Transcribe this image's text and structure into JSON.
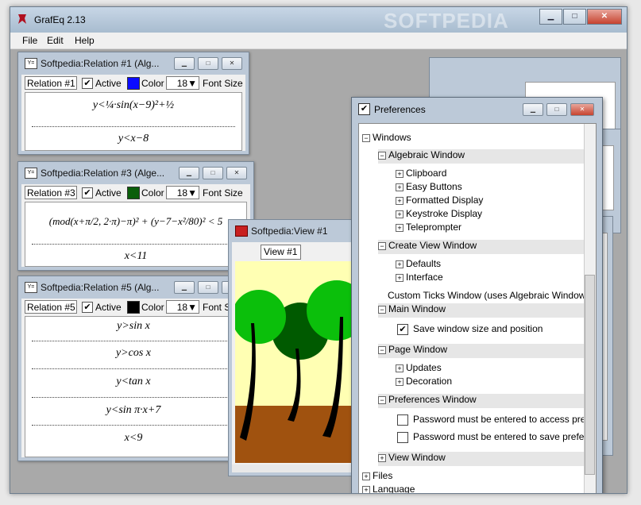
{
  "app": {
    "title": "GrafEq 2.13",
    "watermark": "SOFTPEDIA"
  },
  "menu": [
    "File",
    "Edit",
    "Help"
  ],
  "relations": [
    {
      "title": "Softpedia:Relation #1 (Alg...",
      "name": "Relation #1",
      "active_label": "Active",
      "active": true,
      "color_label": "Color",
      "color": "#0b0bff",
      "font_size": "18",
      "font_size_label": "Font Size",
      "formulas": [
        "y<¼·sin(x−9)²+½",
        "y<x−8"
      ]
    },
    {
      "title": "Softpedia:Relation #3 (Alge...",
      "name": "Relation #3",
      "active_label": "Active",
      "active": true,
      "color_label": "Color",
      "color": "#0a5e0a",
      "font_size": "18",
      "font_size_label": "Font Size",
      "formulas": [
        "(mod(x+π/2, 2·π)−π)² + (y−7−x²/80)² < 5",
        "x<11"
      ]
    },
    {
      "title": "Softpedia:Relation #5 (Alg...",
      "name": "Relation #5",
      "active_label": "Active",
      "active": true,
      "color_label": "Color",
      "color": "#000000",
      "font_size": "18",
      "font_size_label": "Font S",
      "formulas": [
        "y>sin x",
        "y>cos x",
        "y<tan x",
        "y<sin π·x+7",
        "x<9"
      ]
    }
  ],
  "view": {
    "title": "Softpedia:View #1",
    "name": "View #1"
  },
  "preferences": {
    "title": "Preferences",
    "windows_label": "Windows",
    "sections": [
      {
        "label": "Algebraic Window",
        "children": [
          "Clipboard",
          "Easy Buttons",
          "Formatted Display",
          "Keystroke Display",
          "Teleprompter"
        ]
      },
      {
        "label": "Create View Window",
        "children": [
          "Defaults",
          "Interface"
        ]
      },
      {
        "label": "Main Window",
        "note": "Custom Ticks Window (uses Algebraic Window",
        "checkboxes": [
          {
            "label": "Save window size and position",
            "checked": true
          }
        ]
      },
      {
        "label": "Page Window",
        "children": [
          "Updates",
          "Decoration"
        ]
      },
      {
        "label": "Preferences Window",
        "checkboxes": [
          {
            "label": "Password must be entered to access prefe",
            "checked": false
          },
          {
            "label": "Password must be entered to save prefer",
            "checked": false
          }
        ]
      },
      {
        "label": "View Window"
      }
    ],
    "top_items": [
      "Files",
      "Language"
    ]
  },
  "icons": {
    "collapse": "minus-box-icon",
    "expand": "plus-box-icon"
  }
}
